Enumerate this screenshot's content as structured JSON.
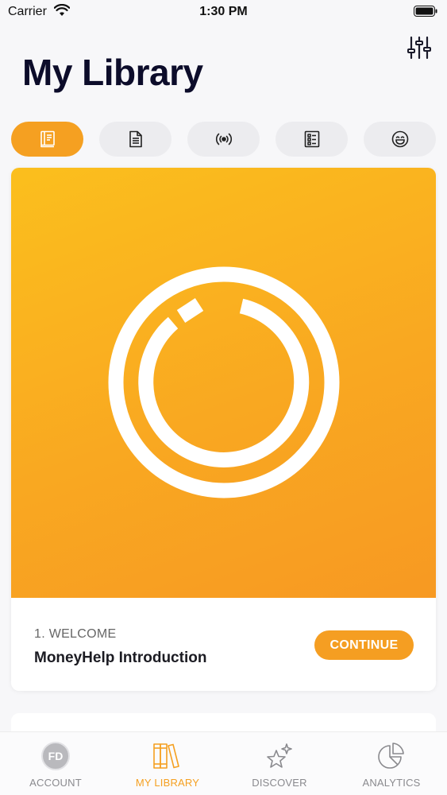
{
  "status_bar": {
    "carrier": "Carrier",
    "time": "1:30 PM"
  },
  "header": {
    "title": "My Library",
    "filter_icon": "sliders-icon"
  },
  "tabs": [
    {
      "icon": "book-icon",
      "active": true
    },
    {
      "icon": "document-icon",
      "active": false
    },
    {
      "icon": "broadcast-icon",
      "active": false
    },
    {
      "icon": "checklist-icon",
      "active": false
    },
    {
      "icon": "smiley-icon",
      "active": false
    }
  ],
  "card": {
    "subtitle": "1. WELCOME",
    "title": "MoneyHelp Introduction",
    "button_label": "CONTINUE"
  },
  "bottom_nav": {
    "items": [
      {
        "label": "ACCOUNT",
        "avatar_initials": "FD",
        "active": false
      },
      {
        "label": "MY LIBRARY",
        "icon": "books-icon",
        "active": true
      },
      {
        "label": "DISCOVER",
        "icon": "sparkle-star-icon",
        "active": false
      },
      {
        "label": "ANALYTICS",
        "icon": "pie-chart-icon",
        "active": false
      }
    ]
  },
  "colors": {
    "accent": "#f5a021",
    "title": "#0c0c2a",
    "inactive_tab": "#ececef",
    "nav_inactive": "#8a8a8e"
  }
}
